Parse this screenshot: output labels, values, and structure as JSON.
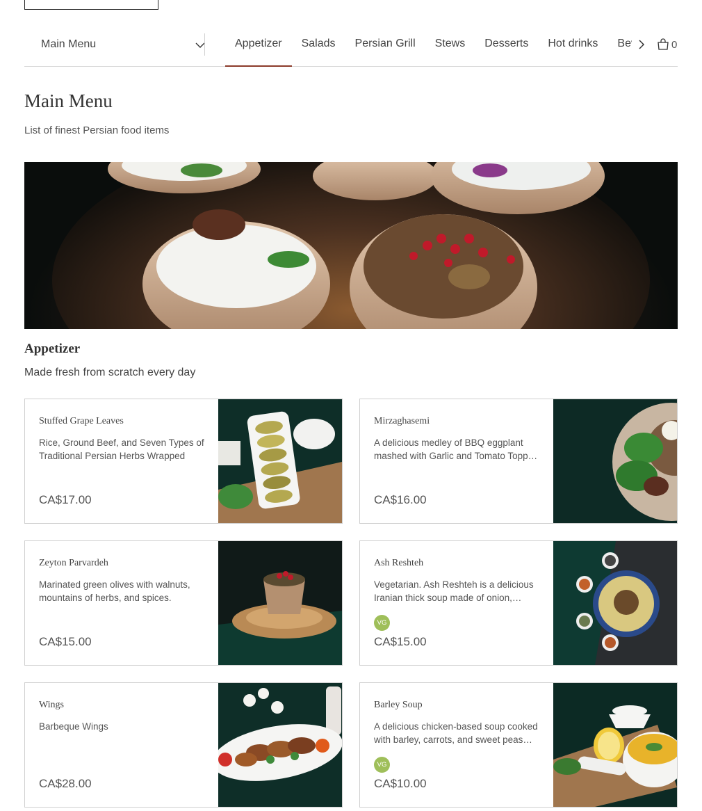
{
  "menu_select": {
    "label": "Main Menu"
  },
  "tabs": [
    {
      "label": "Appetizer",
      "active": true
    },
    {
      "label": "Salads"
    },
    {
      "label": "Persian Grill"
    },
    {
      "label": "Stews"
    },
    {
      "label": "Desserts"
    },
    {
      "label": "Hot drinks"
    },
    {
      "label": "Beverages"
    }
  ],
  "cart": {
    "count": "0"
  },
  "page": {
    "title": "Main Menu",
    "subtitle": "List of finest Persian food items"
  },
  "section": {
    "title": "Appetizer",
    "description": "Made fresh from scratch every day"
  },
  "items": [
    {
      "name": "Stuffed Grape Leaves",
      "description": "Rice, Ground Beef, and Seven Types of Traditional Persian Herbs Wrapped wi…",
      "price": "CA$17.00"
    },
    {
      "name": "Mirzaghasemi",
      "description": "A delicious medley of BBQ eggplant mashed with Garlic and Tomato Topp…",
      "price": "CA$16.00"
    },
    {
      "name": "Zeyton Parvardeh",
      "description": "Marinated green olives with walnuts, mountains of herbs, and spices.",
      "price": "CA$15.00"
    },
    {
      "name": "Ash Reshteh",
      "description": "Vegetarian. Ash Reshteh is a delicious Iranian thick soup made of onion,…",
      "badge": "VG",
      "price": "CA$15.00"
    },
    {
      "name": "Wings",
      "description": "Barbeque Wings",
      "price": "CA$28.00"
    },
    {
      "name": "Barley Soup",
      "description": "A delicious chicken-based soup cooked with barley, carrots, and sweet peas…",
      "badge": "VG",
      "price": "CA$10.00"
    }
  ],
  "colors": {
    "accent": "#8b3a2a",
    "badge": "#9fbf5a",
    "dark_velvet": "#0c2a24"
  }
}
